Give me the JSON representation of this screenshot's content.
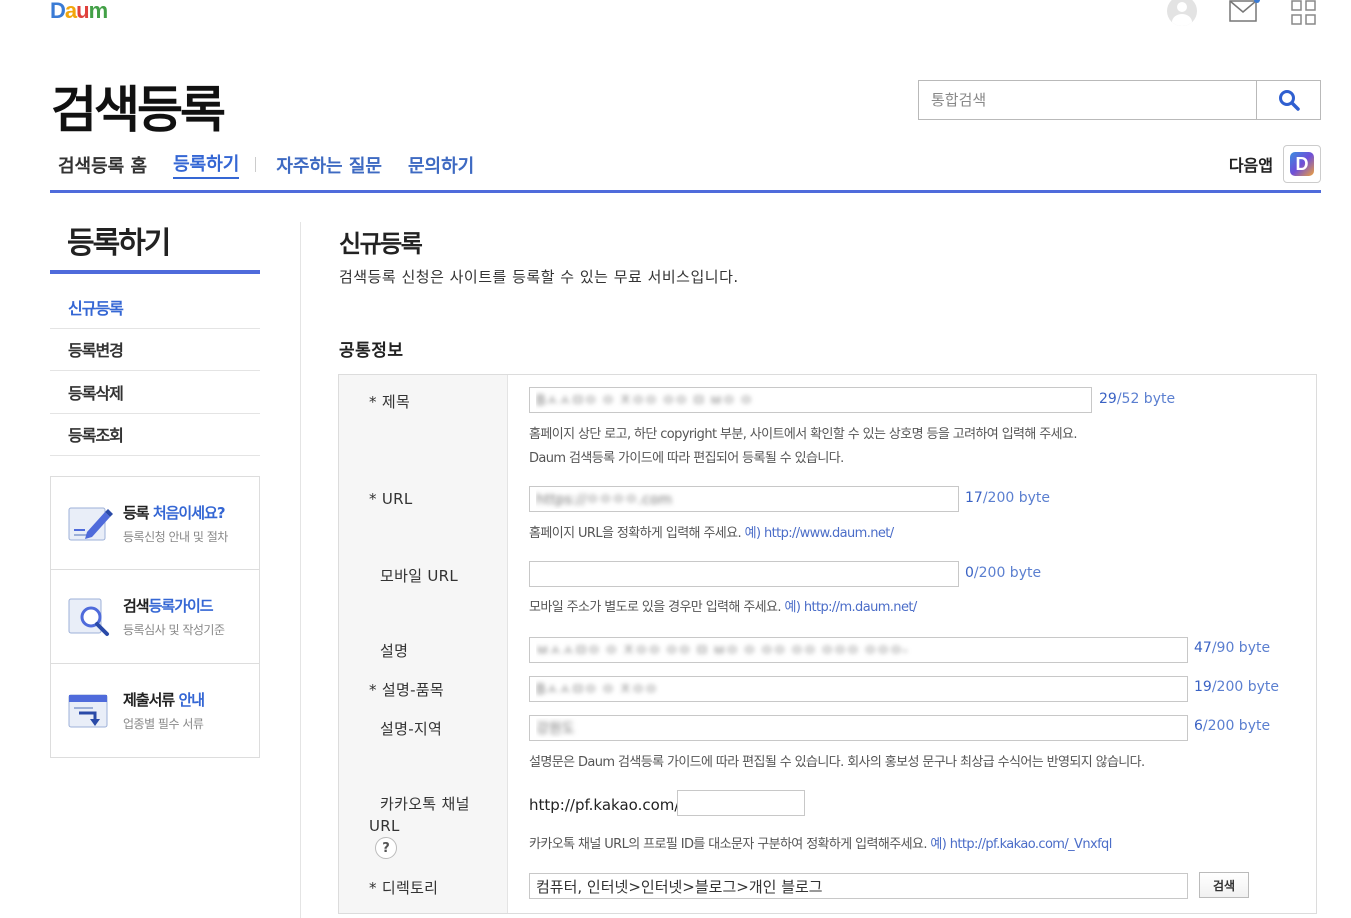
{
  "header": {
    "logo": [
      "D",
      "a",
      "u",
      "m"
    ],
    "title": "검색등록",
    "search_placeholder": "통합검색",
    "app_label": "다음앱",
    "app_badge": "D"
  },
  "gnb": {
    "home": "검색등록 홈",
    "register": "등록하기",
    "faq": "자주하는 질문",
    "contact": "문의하기"
  },
  "sidebar": {
    "title": "등록하기",
    "items": [
      {
        "label": "신규등록",
        "active": true
      },
      {
        "label": "등록변경"
      },
      {
        "label": "등록삭제"
      },
      {
        "label": "등록조회"
      }
    ],
    "guides": [
      {
        "title_a": "등록 ",
        "title_b": "처음이세요?",
        "sub": "등록신청 안내 및 절차"
      },
      {
        "title_a": "검색",
        "title_b": "등록가이드",
        "sub": "등록심사 및 작성기준"
      },
      {
        "title_a": "제출서류 ",
        "title_b": "안내",
        "sub": "업종별 필수 서류"
      }
    ]
  },
  "content": {
    "title": "신규등록",
    "description": "검색등록 신청은 사이트를 등록할 수 있는 무료 서비스입니다.",
    "section_title": "공통정보"
  },
  "form": {
    "title": {
      "label": "* 제목",
      "value": "Bㅅㅅㅁㅇ ㅇ ㅈㅇㅇ ㅇㅇ ㅁ ㅂㅇ ㅇ",
      "count": "29",
      "max": "/52 byte",
      "help1": "홈페이지 상단 로고, 하단 copyright 부분, 사이트에서 확인할 수 있는 상호명 등을 고려하여 입력해 주세요.",
      "help2": "Daum 검색등록 가이드에 따라 편집되어 등록될 수 있습니다."
    },
    "url": {
      "label": "* URL",
      "value": "https://ㅇㅇㅇㅇ.com",
      "count": "17",
      "max": "/200 byte",
      "help": "홈페이지 URL을 정확하게 입력해 주세요. ",
      "example": "예) http://www.daum.net/"
    },
    "mobile_url": {
      "label": "모바일 URL",
      "value": "",
      "count": "0",
      "max": "/200 byte",
      "help": "모바일 주소가 별도로 있을 경우만 입력해 주세요. ",
      "example": "예) http://m.daum.net/"
    },
    "desc": {
      "label": "설명",
      "value": "ㅂㅅㅅㅁㅇ ㅇ ㅈㅇㅇ ㅇㅇ ㅁ ㅂㅇ ㅇ ㅇㅇ ㅇㅇ ㅇㅇㅇ ㅇㅇㅇ-",
      "count": "47",
      "max": "/90 byte"
    },
    "desc_item": {
      "label": "* 설명-품목",
      "value": "Bㅅㅅㅁㅇ ㅇ ㅈㅇㅇ",
      "count": "19",
      "max": "/200 byte"
    },
    "desc_region": {
      "label": "설명-지역",
      "value": "강원도",
      "count": "6",
      "max": "/200 byte",
      "help": "설명문은 Daum 검색등록 가이드에 따라 편집될 수 있습니다. 회사의 홍보성 문구나 최상급 수식어는 반영되지 않습니다."
    },
    "kakao": {
      "label": "카카오톡 채널",
      "label2": "URL",
      "help_icon": "?",
      "prefix": "http://pf.kakao.com/",
      "value": "",
      "help": "카카오톡 채널 URL의 프로필 ID를 대소문자 구분하여 정확하게 입력해주세요. ",
      "example": "예) http://pf.kakao.com/_Vnxfql"
    },
    "directory": {
      "label": "* 디렉토리",
      "value": "컴퓨터, 인터넷>인터넷>블로그>개인 블로그",
      "button": "검색"
    }
  },
  "colors": {
    "accent": "#4f6bdb",
    "link": "#3567d4"
  }
}
